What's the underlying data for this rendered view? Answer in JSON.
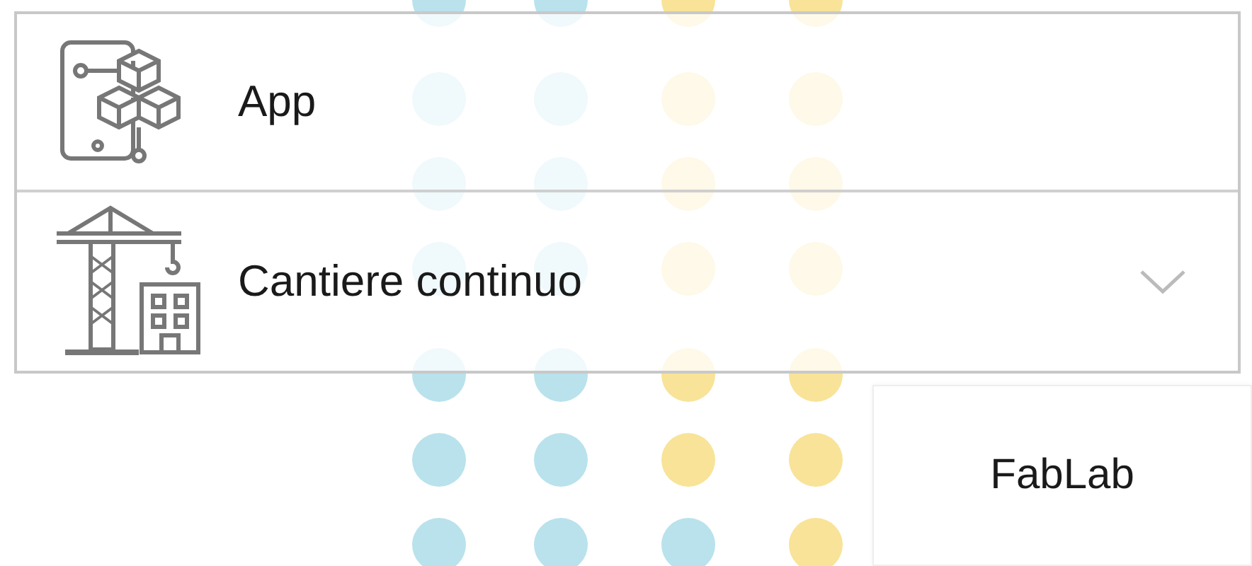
{
  "menu": [
    {
      "label": "App",
      "kind": "app",
      "expandable": false
    },
    {
      "label": "Cantiere continuo",
      "kind": "construction",
      "expandable": true
    }
  ],
  "tile": {
    "label": "FabLab"
  }
}
